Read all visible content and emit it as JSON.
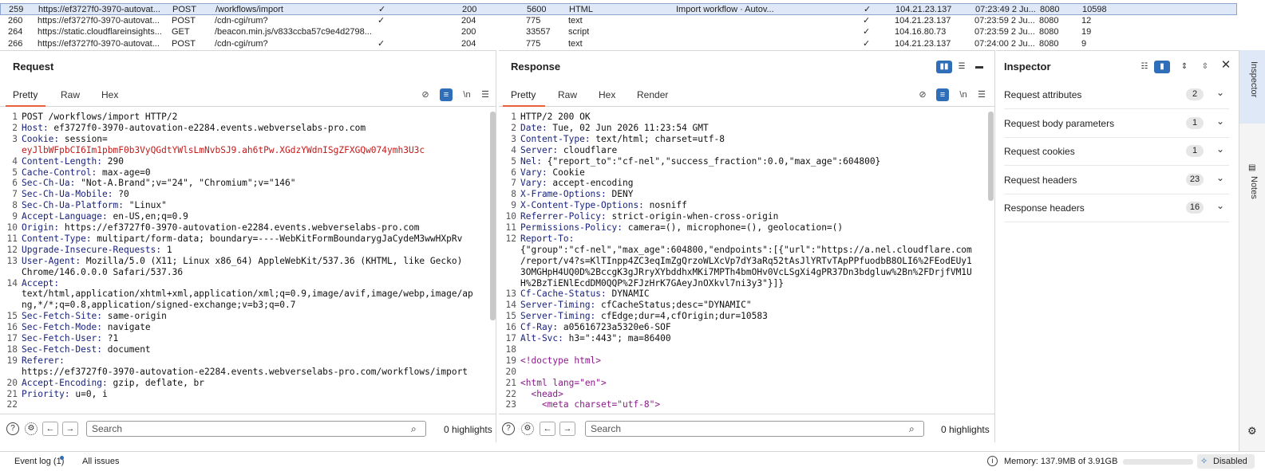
{
  "history": {
    "rows": [
      {
        "num": "259",
        "url": "https://ef3727f0-3970-autovat...",
        "method": "POST",
        "path": "/workflows/import",
        "edited": "✓",
        "status": "200",
        "length": "5600",
        "mime": "HTML",
        "title": "Import workflow · Autov...",
        "tls": "✓",
        "ip": "104.21.23.137",
        "time": "07:23:49 2 Ju...",
        "port": "8080",
        "id": "10598"
      },
      {
        "num": "260",
        "url": "https://ef3727f0-3970-autovat...",
        "method": "POST",
        "path": "/cdn-cgi/rum?",
        "edited": "✓",
        "status": "204",
        "length": "775",
        "mime": "text",
        "title": "",
        "tls": "✓",
        "ip": "104.21.23.137",
        "time": "07:23:59 2 Ju...",
        "port": "8080",
        "id": "12"
      },
      {
        "num": "264",
        "url": "https://static.cloudflareinsights...",
        "method": "GET",
        "path": "/beacon.min.js/v833ccba57c9e4d2798...",
        "edited": "",
        "status": "200",
        "length": "33557",
        "mime": "script",
        "title": "",
        "tls": "✓",
        "ip": "104.16.80.73",
        "time": "07:23:59 2 Ju...",
        "port": "8080",
        "id": "19"
      },
      {
        "num": "266",
        "url": "https://ef3727f0-3970-autovat...",
        "method": "POST",
        "path": "/cdn-cgi/rum?",
        "edited": "✓",
        "status": "204",
        "length": "775",
        "mime": "text",
        "title": "",
        "tls": "✓",
        "ip": "104.21.23.137",
        "time": "07:24:00 2 Ju...",
        "port": "8080",
        "id": "9"
      }
    ]
  },
  "request": {
    "title": "Request",
    "tabs": [
      "Pretty",
      "Raw",
      "Hex"
    ],
    "newline_label": "\\n",
    "lines": [
      {
        "n": "1",
        "t": "POST /workflows/import HTTP/2"
      },
      {
        "n": "2",
        "k": "Host:",
        "t": " ef3727f0-3970-autovation-e2284.events.webverselabs-pro.com"
      },
      {
        "n": "3",
        "k": "Cookie:",
        "t": " session="
      },
      {
        "n": "",
        "t": "eyJlbWFpbCI6Im1pbmF0b3VyQGdtYWlsLmNvbSJ9.ah6tPw.XGdzYWdnISgZFXGQw074ymh3U3c",
        "red": true
      },
      {
        "n": "4",
        "k": "Content-Length:",
        "t": " 290"
      },
      {
        "n": "5",
        "k": "Cache-Control:",
        "t": " max-age=0"
      },
      {
        "n": "6",
        "k": "Sec-Ch-Ua:",
        "t": " \"Not-A.Brand\";v=\"24\", \"Chromium\";v=\"146\""
      },
      {
        "n": "7",
        "k": "Sec-Ch-Ua-Mobile:",
        "t": " ?0"
      },
      {
        "n": "8",
        "k": "Sec-Ch-Ua-Platform:",
        "t": " \"Linux\""
      },
      {
        "n": "9",
        "k": "Accept-Language:",
        "t": " en-US,en;q=0.9"
      },
      {
        "n": "10",
        "k": "Origin:",
        "t": " https://ef3727f0-3970-autovation-e2284.events.webverselabs-pro.com"
      },
      {
        "n": "11",
        "k": "Content-Type:",
        "t": " multipart/form-data; boundary=----WebKitFormBoundarygJaCydeM3wwHXpRv"
      },
      {
        "n": "12",
        "k": "Upgrade-Insecure-Requests:",
        "t": " 1"
      },
      {
        "n": "13",
        "k": "User-Agent:",
        "t": " Mozilla/5.0 (X11; Linux x86_64) AppleWebKit/537.36 (KHTML, like Gecko)"
      },
      {
        "n": "",
        "t": "Chrome/146.0.0.0 Safari/537.36"
      },
      {
        "n": "14",
        "k": "Accept:",
        "t": ""
      },
      {
        "n": "",
        "t": "text/html,application/xhtml+xml,application/xml;q=0.9,image/avif,image/webp,image/ap"
      },
      {
        "n": "",
        "t": "ng,*/*;q=0.8,application/signed-exchange;v=b3;q=0.7"
      },
      {
        "n": "15",
        "k": "Sec-Fetch-Site:",
        "t": " same-origin"
      },
      {
        "n": "16",
        "k": "Sec-Fetch-Mode:",
        "t": " navigate"
      },
      {
        "n": "17",
        "k": "Sec-Fetch-User:",
        "t": " ?1"
      },
      {
        "n": "18",
        "k": "Sec-Fetch-Dest:",
        "t": " document"
      },
      {
        "n": "19",
        "k": "Referer:",
        "t": ""
      },
      {
        "n": "",
        "t": "https://ef3727f0-3970-autovation-e2284.events.webverselabs-pro.com/workflows/import"
      },
      {
        "n": "20",
        "k": "Accept-Encoding:",
        "t": " gzip, deflate, br"
      },
      {
        "n": "21",
        "k": "Priority:",
        "t": " u=0, i"
      },
      {
        "n": "22",
        "t": ""
      }
    ],
    "search_placeholder": "Search",
    "highlights": "0 highlights"
  },
  "response": {
    "title": "Response",
    "tabs": [
      "Pretty",
      "Raw",
      "Hex",
      "Render"
    ],
    "newline_label": "\\n",
    "lines": [
      {
        "n": "1",
        "t": "HTTP/2 200 OK"
      },
      {
        "n": "2",
        "k": "Date:",
        "t": " Tue, 02 Jun 2026 11:23:54 GMT"
      },
      {
        "n": "3",
        "k": "Content-Type:",
        "t": " text/html; charset=utf-8"
      },
      {
        "n": "4",
        "k": "Server:",
        "t": " cloudflare"
      },
      {
        "n": "5",
        "k": "Nel:",
        "t": " {\"report_to\":\"cf-nel\",\"success_fraction\":0.0,\"max_age\":604800}"
      },
      {
        "n": "6",
        "k": "Vary:",
        "t": " Cookie"
      },
      {
        "n": "7",
        "k": "Vary:",
        "t": " accept-encoding"
      },
      {
        "n": "8",
        "k": "X-Frame-Options:",
        "t": " DENY"
      },
      {
        "n": "9",
        "k": "X-Content-Type-Options:",
        "t": " nosniff"
      },
      {
        "n": "10",
        "k": "Referrer-Policy:",
        "t": " strict-origin-when-cross-origin"
      },
      {
        "n": "11",
        "k": "Permissions-Policy:",
        "t": " camera=(), microphone=(), geolocation=()"
      },
      {
        "n": "12",
        "k": "Report-To:",
        "t": ""
      },
      {
        "n": "",
        "t": "{\"group\":\"cf-nel\",\"max_age\":604800,\"endpoints\":[{\"url\":\"https://a.nel.cloudflare.com"
      },
      {
        "n": "",
        "t": "/report/v4?s=KlTInpp4ZC3eqImZgQrzoWLXcVp7dY3aRq52tAsJlYRTvTApPPfuodbB8OLI6%2FEodEUy1"
      },
      {
        "n": "",
        "t": "3OMGHpH4UQ0D%2BccgK3gJRryXYbddhxMKi7MPTh4bmOHv0VcLSgXi4gPR37Dn3bdgluw%2Bn%2FDrjfVM1U"
      },
      {
        "n": "",
        "t": "H%2BzTiENlEcdDM0QQP%2FJzHrK7GAeyJnOXkvl7ni3y3\"}]}"
      },
      {
        "n": "13",
        "k": "Cf-Cache-Status:",
        "t": " DYNAMIC"
      },
      {
        "n": "14",
        "k": "Server-Timing:",
        "t": " cfCacheStatus;desc=\"DYNAMIC\""
      },
      {
        "n": "15",
        "k": "Server-Timing:",
        "t": " cfEdge;dur=4,cfOrigin;dur=10583"
      },
      {
        "n": "16",
        "k": "Cf-Ray:",
        "t": " a05616723a5320e6-SOF"
      },
      {
        "n": "17",
        "k": "Alt-Svc:",
        "t": " h3=\":443\"; ma=86400"
      },
      {
        "n": "18",
        "t": ""
      },
      {
        "n": "19",
        "t": "<!doctype html>",
        "tag": true
      },
      {
        "n": "20",
        "t": ""
      },
      {
        "n": "21",
        "t": "<html lang=\"en\">",
        "tag": true
      },
      {
        "n": "22",
        "t": "  <head>",
        "tag": true
      },
      {
        "n": "23",
        "t": "    <meta charset=\"utf-8\">",
        "tag": true
      }
    ],
    "search_placeholder": "Search",
    "highlights": "0 highlights"
  },
  "inspector": {
    "title": "Inspector",
    "sections": [
      {
        "label": "Request attributes",
        "count": "2"
      },
      {
        "label": "Request body parameters",
        "count": "1"
      },
      {
        "label": "Request cookies",
        "count": "1"
      },
      {
        "label": "Request headers",
        "count": "23"
      },
      {
        "label": "Response headers",
        "count": "16"
      }
    ]
  },
  "rail": {
    "inspector_tab": "Inspector",
    "notes_tab": "Notes"
  },
  "status": {
    "event_log": "Event log (1)",
    "all_issues": "All issues",
    "memory": "Memory: 137.9MB of 3.91GB",
    "disabled": "Disabled"
  },
  "colors": {
    "accent": "#e8613c",
    "selection": "#dfe8f6",
    "header_key": "#1a237e",
    "cookie_value": "#c41a1a",
    "toggle_blue": "#2f6fba"
  }
}
